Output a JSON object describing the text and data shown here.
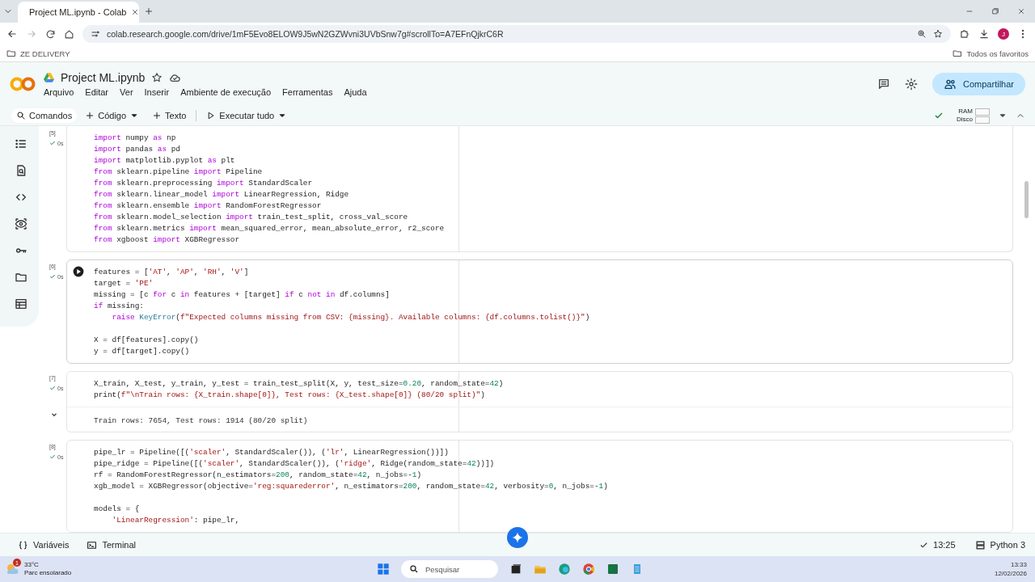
{
  "browser": {
    "tab_title": "Project ML.ipynb - Colab",
    "url": "colab.research.google.com/drive/1mF5Evo8ELOW9J5wN2GZWvni3UVbSnw7g#scrollTo=A7EFnQjkrC6R",
    "profile_initial": "J",
    "bookmarks": [
      "ZE DELIVERY"
    ],
    "all_bookmarks": "Todos os favoritos"
  },
  "notebook": {
    "title": "Project ML.ipynb",
    "menu": [
      "Arquivo",
      "Editar",
      "Ver",
      "Inserir",
      "Ambiente de execução",
      "Ferramentas",
      "Ajuda"
    ],
    "toolbar": [
      {
        "kind": "search",
        "label": "Comandos",
        "dropdown": false
      },
      {
        "kind": "add",
        "label": "Código",
        "dropdown": true
      },
      {
        "kind": "add",
        "label": "Texto",
        "dropdown": false
      },
      {
        "kind": "run",
        "label": "Executar tudo",
        "dropdown": true
      }
    ],
    "share": "Compartilhar",
    "resources": {
      "connected": true,
      "ram": "RAM",
      "disk": "Disco"
    }
  },
  "cells": [
    {
      "count": "[5]",
      "time": "0s",
      "hovered": false,
      "blocks": [
        [
          "import numpy as np",
          "import pandas as pd",
          "import matplotlib.pyplot as plt",
          "from sklearn.pipeline import Pipeline",
          "from sklearn.preprocessing import StandardScaler",
          "from sklearn.linear_model import LinearRegression, Ridge",
          "from sklearn.ensemble import RandomForestRegressor",
          "from sklearn.model_selection import train_test_split, cross_val_score",
          "from sklearn.metrics import mean_squared_error, mean_absolute_error, r2_score",
          "from xgboost import XGBRegressor"
        ]
      ]
    },
    {
      "count": "[6]",
      "time": "0s",
      "hovered": true,
      "blocks": [
        [
          "features = ['AT', 'AP', 'RH', 'V']",
          "target = 'PE'",
          "missing = [c for c in features + [target] if c not in df.columns]",
          "if missing:",
          "    raise KeyError(f\"Expected columns missing from CSV: {missing}. Available columns: {df.columns.tolist()}\")"
        ],
        [
          "X = df[features].copy()",
          "y = df[target].copy()"
        ]
      ]
    },
    {
      "count": "[7]",
      "time": "0s",
      "hovered": false,
      "blocks": [
        [
          "X_train, X_test, y_train, y_test = train_test_split(X, y, test_size=0.20, random_state=42)",
          "print(f\"\\nTrain rows: {X_train.shape[0]}, Test rows: {X_test.shape[0]} (80/20 split)\")"
        ]
      ],
      "output": {
        "expanded": true,
        "lines": [
          "Train rows: 7654, Test rows: 1914 (80/20 split)"
        ]
      }
    },
    {
      "count": "[8]",
      "time": "0s",
      "hovered": false,
      "blocks": [
        [
          "pipe_lr = Pipeline([('scaler', StandardScaler()), ('lr', LinearRegression())])",
          "pipe_ridge = Pipeline([('scaler', StandardScaler()), ('ridge', Ridge(random_state=42))])",
          "rf = RandomForestRegressor(n_estimators=200, random_state=42, n_jobs=-1)",
          "xgb_model = XGBRegressor(objective='reg:squarederror', n_estimators=200, random_state=42, verbosity=0, n_jobs=-1)"
        ],
        [
          "models = {",
          "    'LinearRegression': pipe_lr,"
        ]
      ]
    }
  ],
  "status_bar": {
    "items": [
      {
        "kind": "variables",
        "label": "Variáveis"
      },
      {
        "kind": "terminal",
        "label": "Terminal"
      }
    ],
    "last_run": "13:25",
    "runtime": "Python 3"
  },
  "taskbar": {
    "weather_badge": "1",
    "weather_temp": "33°C",
    "weather_text": "Parc ensolarado",
    "search_placeholder": "Pesquisar",
    "time": "13:33",
    "date": "12/02/2026"
  }
}
